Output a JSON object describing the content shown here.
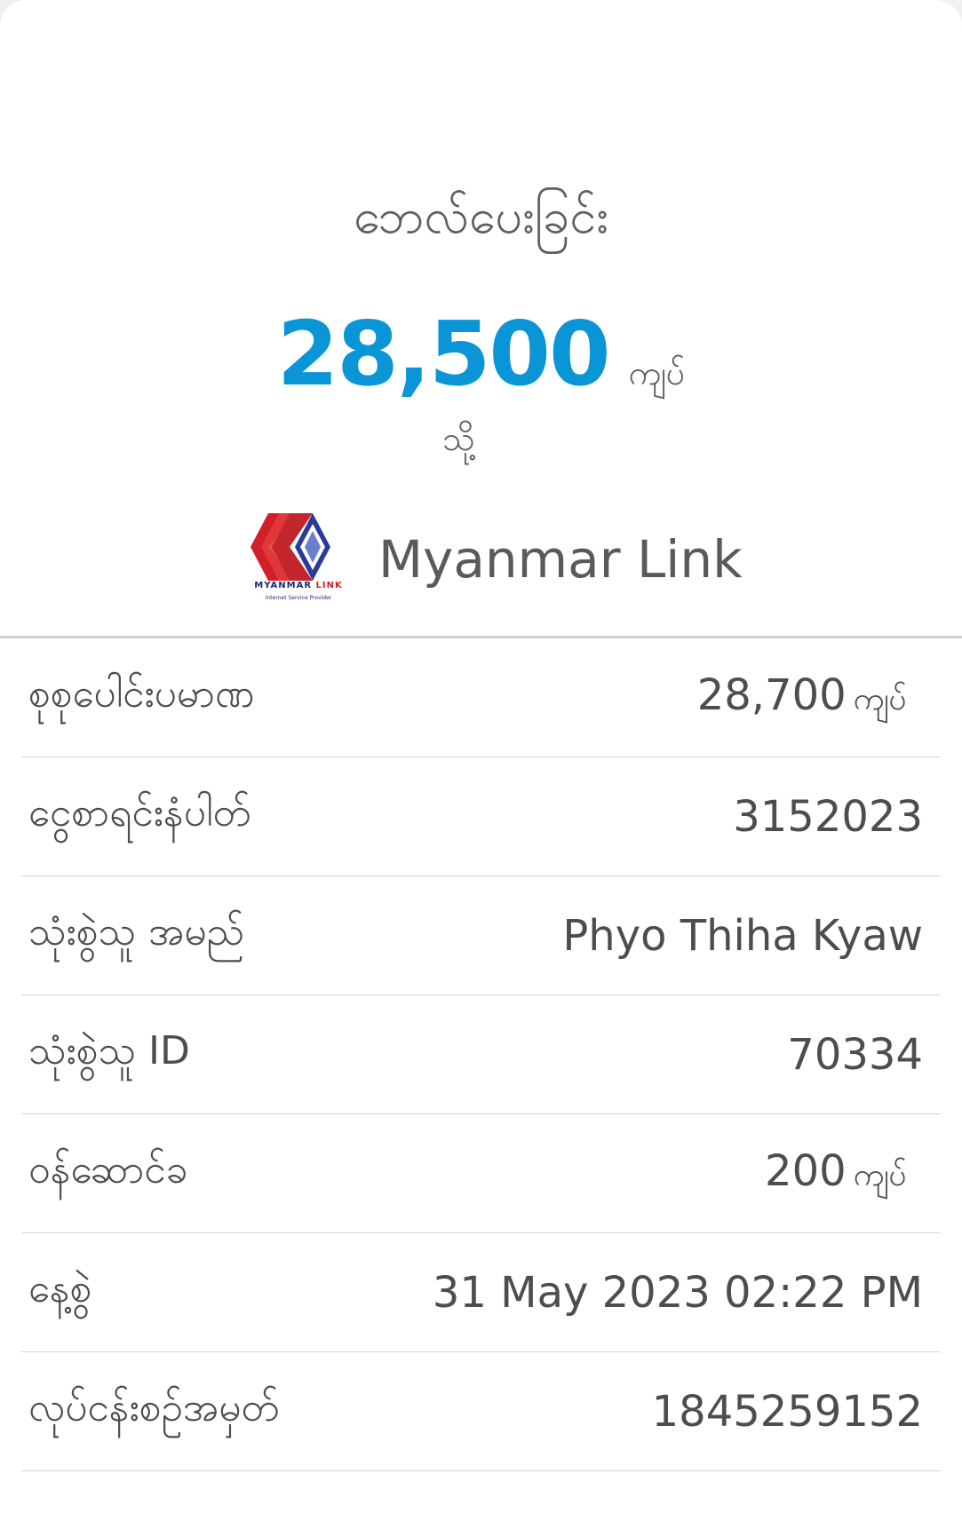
{
  "header": {
    "title": "ဘေလ်ပေးခြင်း",
    "amount": "28,500",
    "amount_unit": "ကျပ်",
    "to_label": "သို့",
    "biller_name": "Myanmar Link",
    "logo_text_main": "MYANMAR",
    "logo_text_accent": "LINK",
    "logo_subtext": "Internet Service Provider"
  },
  "rows": [
    {
      "label": "စုစုပေါင်းပမာဏ",
      "value": "28,700",
      "unit": "ကျပ်"
    },
    {
      "label": "ငွေစာရင်းနံပါတ်",
      "value": "3152023"
    },
    {
      "label": "သုံးစွဲသူ အမည်",
      "value": "Phyo Thiha Kyaw"
    },
    {
      "label": "သုံးစွဲသူ ID",
      "value": "70334"
    },
    {
      "label": "ဝန်ဆောင်ခ",
      "value": "200",
      "unit": "ကျပ်"
    },
    {
      "label": "နေ့စွဲ",
      "value": "31 May 2023 02:22 PM"
    },
    {
      "label": "လုပ်ငန်းစဉ်အမှတ်",
      "value": "1845259152"
    }
  ],
  "colors": {
    "amount": "#0a96d6",
    "text": "#4d4d4d",
    "logo_red": "#d21f2b",
    "logo_blue": "#1d2a74"
  }
}
